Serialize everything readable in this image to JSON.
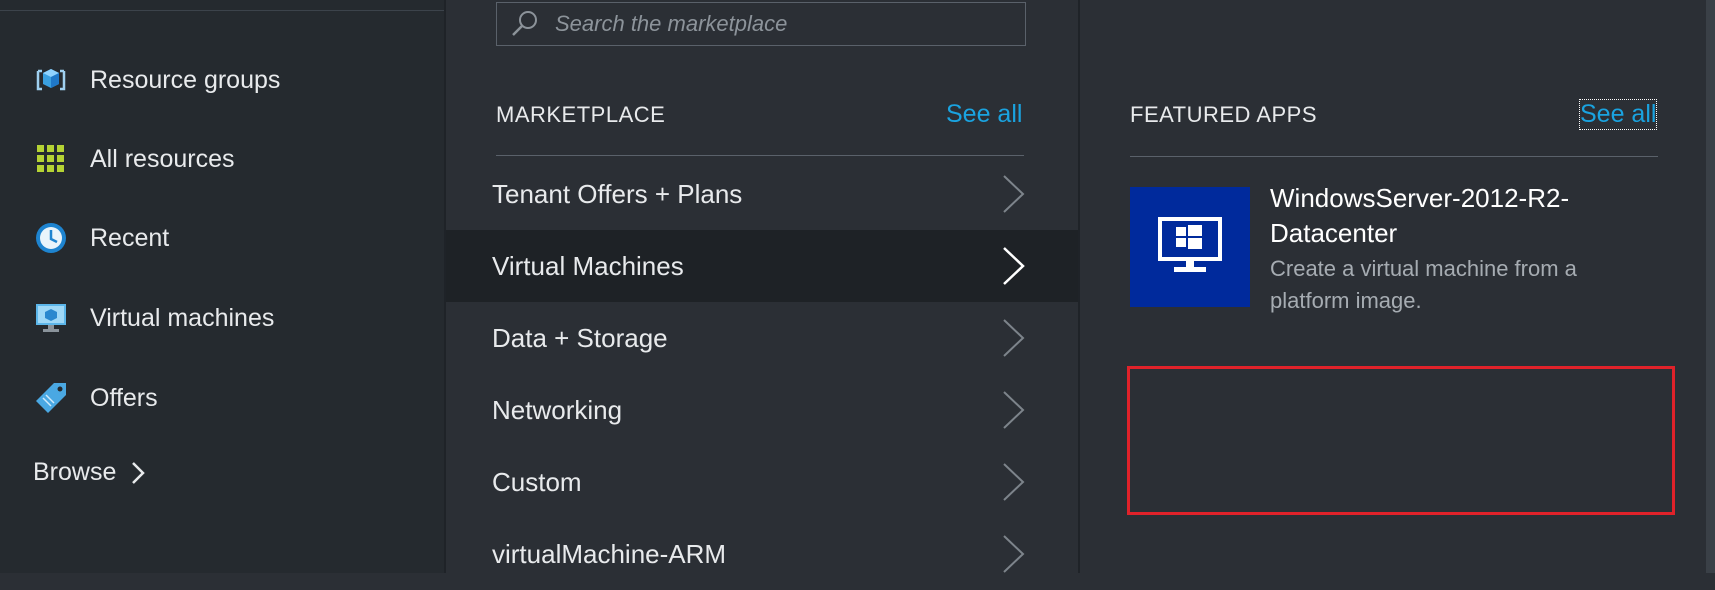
{
  "sidebar": {
    "items": [
      {
        "label": "Resource groups",
        "icon": "resource-groups-icon"
      },
      {
        "label": "All resources",
        "icon": "all-resources-grid-icon"
      },
      {
        "label": "Recent",
        "icon": "clock-icon"
      },
      {
        "label": "Virtual machines",
        "icon": "virtual-machine-monitor-icon"
      },
      {
        "label": "Offers",
        "icon": "tag-icon"
      }
    ],
    "browse_label": "Browse"
  },
  "search": {
    "placeholder": "Search the marketplace"
  },
  "marketplace": {
    "header": "MARKETPLACE",
    "see_all": "See all",
    "items": [
      {
        "label": "Tenant Offers + Plans"
      },
      {
        "label": "Virtual Machines",
        "selected": true
      },
      {
        "label": "Data + Storage"
      },
      {
        "label": "Networking"
      },
      {
        "label": "Custom"
      },
      {
        "label": "virtualMachine-ARM"
      }
    ]
  },
  "featured": {
    "header": "FEATURED APPS",
    "see_all": "See all",
    "app": {
      "title": "WindowsServer-2012-R2-Datacenter",
      "description": "Create a virtual machine from a platform image.",
      "icon": "windows-monitor-icon"
    }
  },
  "colors": {
    "accent": "#1aa3e0",
    "highlight_box": "#e0222a",
    "tile_bg": "#002a9c"
  }
}
